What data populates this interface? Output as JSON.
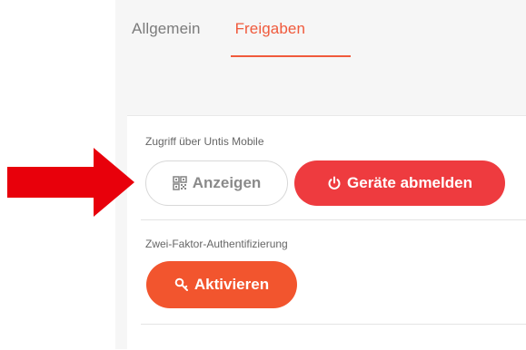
{
  "tabs": [
    {
      "label": "Allgemein",
      "active": false
    },
    {
      "label": "Freigaben",
      "active": true
    }
  ],
  "mobile_access": {
    "label": "Zugriff über Untis Mobile",
    "show_button": {
      "label": "Anzeigen",
      "icon": "qr-code-icon"
    },
    "logout_button": {
      "label": "Geräte abmelden",
      "icon": "power-icon"
    }
  },
  "two_factor": {
    "label": "Zwei-Faktor-Authentifizierung",
    "activate_button": {
      "label": "Aktivieren",
      "icon": "key-icon"
    }
  },
  "colors": {
    "accent": "#f05a3c",
    "danger": "#ee3b3f",
    "orange": "#f2552e",
    "annotation_arrow": "#e8000b"
  },
  "annotation": {
    "icon": "red-arrow-icon"
  }
}
